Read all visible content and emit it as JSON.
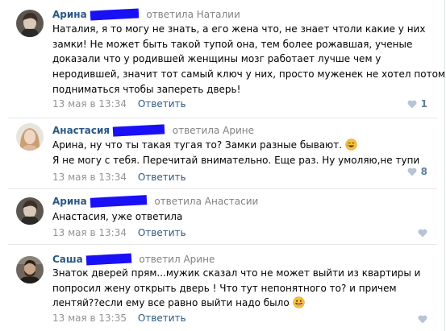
{
  "comments": [
    {
      "author": "Арина",
      "reply_to": "ответила Наталии",
      "lines": [
        "Наталия, я то могу не знать, а его жена что, не знает чтоли какие у них",
        "замки! Не может быть такой тупой она, тем более рожавшая, ученые",
        "доказали что у родившей женщины мозг работает лучше чем у",
        "неродившей, значит тот самый ключ у них, просто муженек не хотел потом",
        "подниматься чтобы запереть дверь!"
      ],
      "date": "13 мая в 13:34",
      "reply_label": "Ответить",
      "likes": "1"
    },
    {
      "author": "Анастасия",
      "reply_to": "ответила Арине",
      "lines": [
        "Арина, ну что ты такая тугая то? Замки разные бывают.",
        "Я не могу с тебя. Перечитай внимательно. Еще раз. Ну умоляю,не тупи"
      ],
      "date": "13 мая в 13:34",
      "reply_label": "Ответить",
      "likes": "8"
    },
    {
      "author": "Арина",
      "reply_to": "ответила Анастасии",
      "lines": [
        "Анастасия, уже ответила"
      ],
      "date": "13 мая в 13:34",
      "reply_label": "Ответить",
      "likes": ""
    },
    {
      "author": "Саша",
      "reply_to": "ответил Арине",
      "lines": [
        "Знаток дверей прям...мужик сказал что не может выйти из квартиры и",
        "попросил жену открыть дверь ! Что тут непонятного то? и причем",
        "лентяй??если ему все равно выйти надо было"
      ],
      "date": "13 мая в 13:35",
      "reply_label": "Ответить",
      "likes": ""
    }
  ],
  "icons": {
    "like": "heart-icon",
    "emoji_laugh": "rofl-emoji",
    "emoji_smile": "grin-emoji"
  },
  "colors": {
    "link": "#2a5885",
    "meta": "#939393",
    "redaction": "#1a10f5",
    "heart": "#b7c4d5"
  }
}
